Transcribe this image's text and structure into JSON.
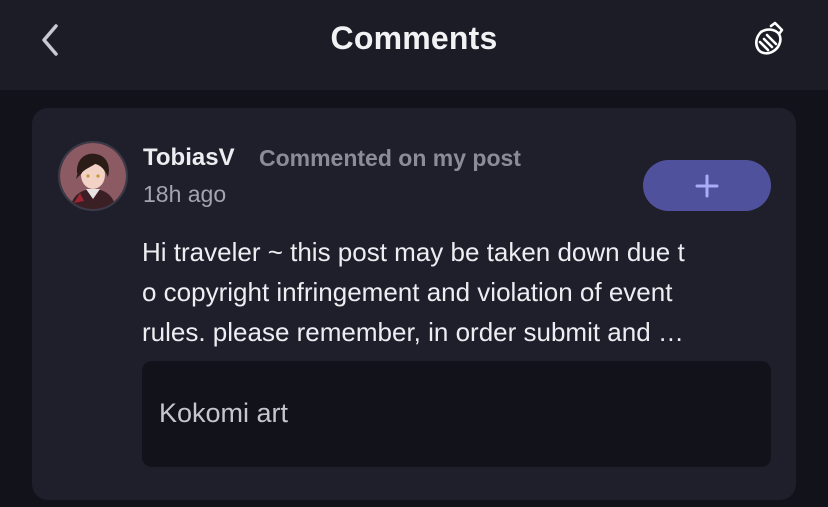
{
  "header": {
    "title": "Comments",
    "back_icon": "chevron-left-icon",
    "clear_icon": "broom-icon"
  },
  "comment": {
    "username": "TobiasV",
    "action": "Commented on my post",
    "time": "18h ago",
    "follow_icon": "plus-icon",
    "body_lines": [
      "Hi traveler ~ this post may be taken down due t",
      "o copyright infringement and violation of event",
      "rules. please remember, in order submit and …"
    ],
    "post_title": "Kokomi art"
  },
  "colors": {
    "background": "#12121b",
    "header": "#1c1c27",
    "card": "#1f1f2b",
    "button": "#4f519c",
    "button_icon": "#a9adf5",
    "post_ref": "#12121a"
  }
}
